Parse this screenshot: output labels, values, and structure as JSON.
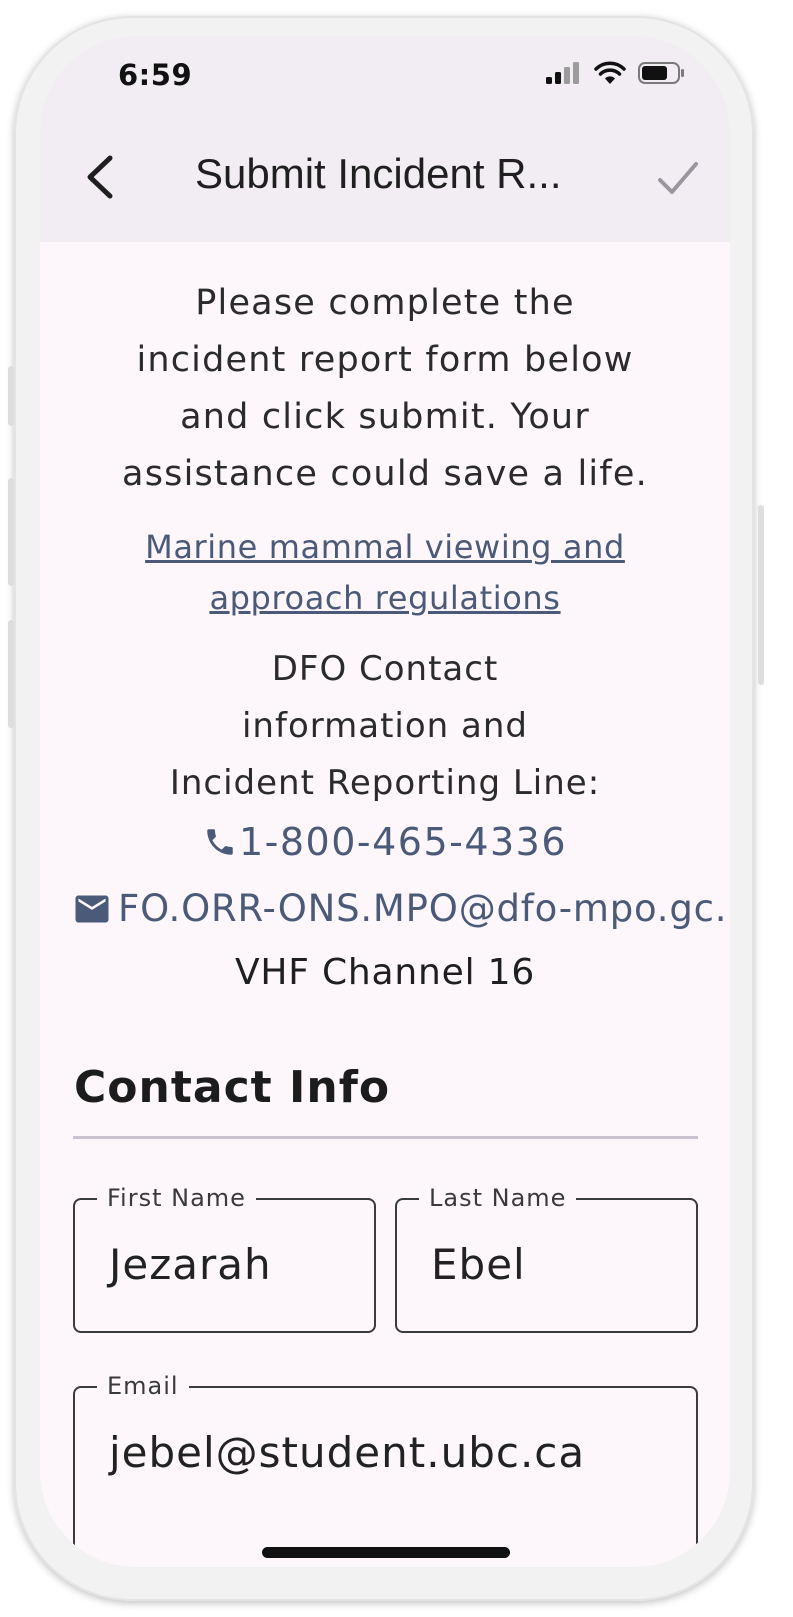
{
  "status_bar": {
    "time": "6:59"
  },
  "app_bar": {
    "title": "Submit Incident R..."
  },
  "intro": {
    "lines": [
      "Please complete the",
      "incident report form below",
      "and click submit. Your",
      "assistance could save a life."
    ]
  },
  "regulations_link": {
    "lines": [
      "Marine mammal viewing and",
      "approach regulations"
    ]
  },
  "dfo_contact": {
    "lines": [
      "DFO Contact",
      "information and",
      "Incident Reporting Line:"
    ],
    "phone": "1-800-465-4336",
    "email": "FO.ORR-ONS.MPO@dfo-mpo.gc.",
    "radio": "VHF Channel 16"
  },
  "contact_info": {
    "title": "Contact Info",
    "fields": {
      "first_name": {
        "label": "First Name",
        "value": "Jezarah"
      },
      "last_name": {
        "label": "Last Name",
        "value": "Ebel"
      },
      "email": {
        "label": "Email",
        "value": "jebel@student.ubc.ca"
      }
    }
  },
  "colors": {
    "link": "#4a5a78",
    "background": "#fdf7fb",
    "app_bar": "#f1edf3",
    "divider": "#c9c3cf"
  },
  "icons": [
    "back-arrow-icon",
    "checkmark-icon",
    "phone-icon",
    "mail-icon",
    "signal-icon",
    "wifi-icon",
    "battery-icon"
  ]
}
